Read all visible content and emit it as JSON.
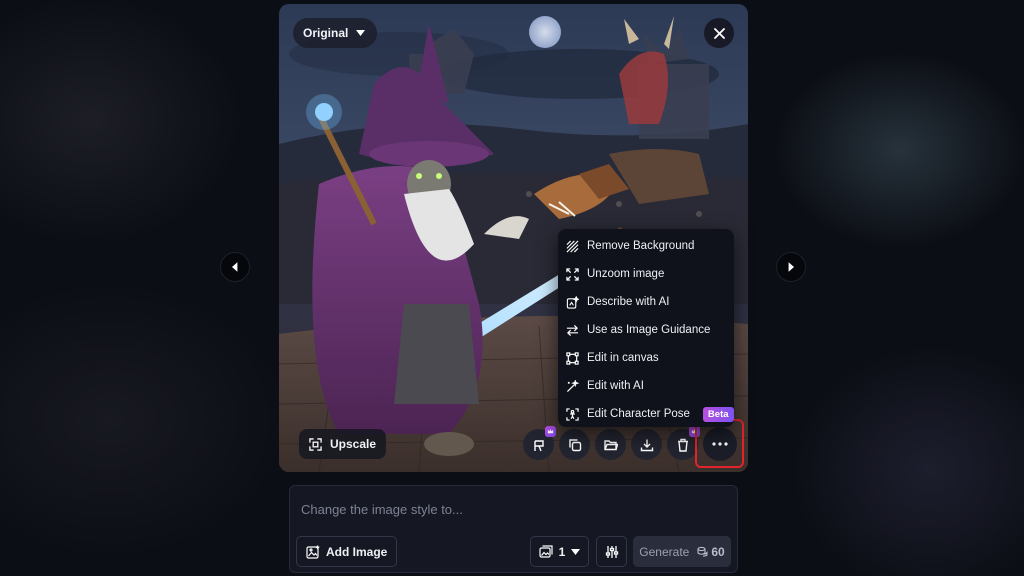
{
  "viewer": {
    "view_mode": "Original",
    "upscale_label": "Upscale"
  },
  "context_menu": {
    "items": [
      {
        "label": "Remove Background",
        "icon": "remove-background-icon"
      },
      {
        "label": "Unzoom image",
        "icon": "unzoom-icon"
      },
      {
        "label": "Describe with AI",
        "icon": "describe-icon"
      },
      {
        "label": "Use as Image Guidance",
        "icon": "swap-arrows-icon"
      },
      {
        "label": "Edit in canvas",
        "icon": "canvas-icon"
      },
      {
        "label": "Edit with AI",
        "icon": "magic-wand-icon"
      },
      {
        "label": "Edit Character Pose",
        "icon": "pose-icon",
        "badge": "Beta"
      }
    ]
  },
  "action_bar": {
    "buttons": [
      "brush-icon",
      "copy-icon",
      "folder-icon",
      "download-icon",
      "trash-icon",
      "more-icon"
    ]
  },
  "prompt": {
    "placeholder": "Change the image style to...",
    "value": "",
    "add_image_label": "Add Image",
    "image_count": "1",
    "generate_label": "Generate",
    "token_cost": "60"
  },
  "colors": {
    "highlight": "#e0242b",
    "accent": "#b64fe0",
    "panel": "#151823"
  }
}
